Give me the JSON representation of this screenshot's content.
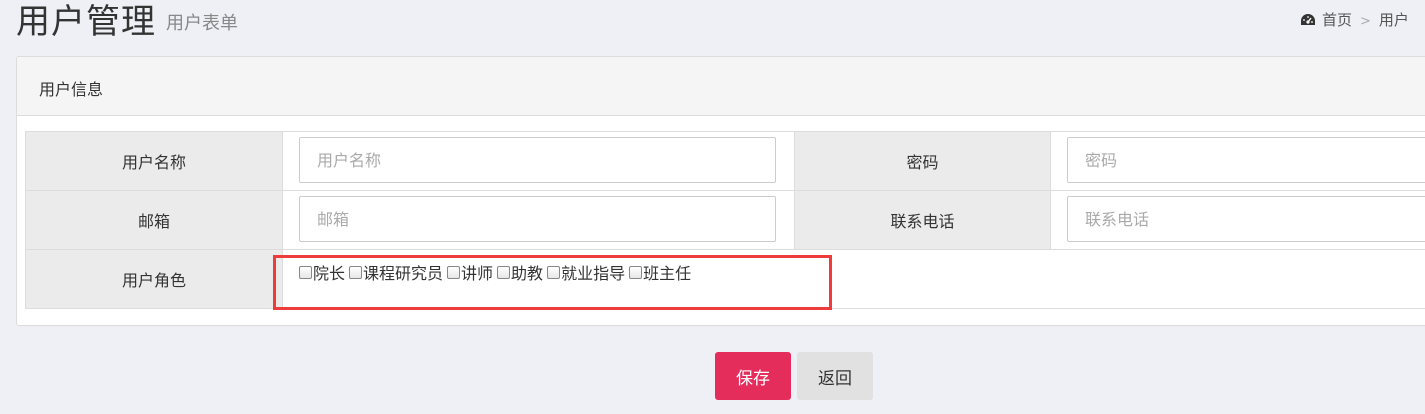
{
  "header": {
    "title": "用户管理",
    "subtitle": "用户表单",
    "breadcrumb": {
      "icon": "dashboard-icon",
      "home": "首页",
      "separator": ">",
      "current": "用户"
    }
  },
  "panel": {
    "title": "用户信息",
    "fields": {
      "username": {
        "label": "用户名称",
        "placeholder": "用户名称",
        "value": ""
      },
      "password": {
        "label": "密码",
        "placeholder": "密码",
        "value": ""
      },
      "email": {
        "label": "邮箱",
        "placeholder": "邮箱",
        "value": ""
      },
      "phone": {
        "label": "联系电话",
        "placeholder": "联系电话",
        "value": ""
      }
    },
    "roles": {
      "label": "用户角色",
      "options": [
        {
          "label": "院长",
          "checked": false
        },
        {
          "label": "课程研究员",
          "checked": false
        },
        {
          "label": "讲师",
          "checked": false
        },
        {
          "label": "助教",
          "checked": false
        },
        {
          "label": "就业指导",
          "checked": false
        },
        {
          "label": "班主任",
          "checked": false
        }
      ]
    }
  },
  "actions": {
    "save_label": "保存",
    "back_label": "返回"
  },
  "colors": {
    "save_button": "#e52d5c",
    "highlight_box": "#ee3b3b",
    "page_background": "#eef0f6"
  }
}
